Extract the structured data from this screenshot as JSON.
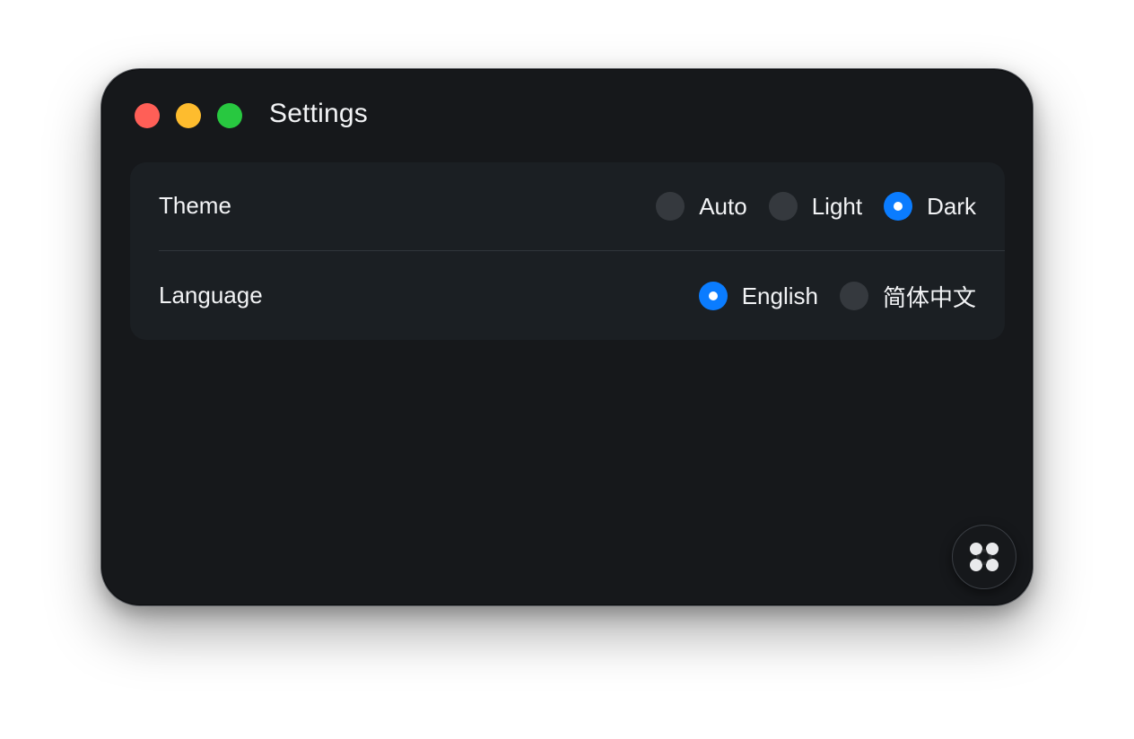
{
  "window": {
    "title": "Settings",
    "traffic_lights": {
      "close": "#ff5f57",
      "minimize": "#febc2e",
      "zoom": "#28c840"
    }
  },
  "settings": {
    "theme": {
      "label": "Theme",
      "options": [
        "Auto",
        "Light",
        "Dark"
      ],
      "selected": "Dark"
    },
    "language": {
      "label": "Language",
      "options": [
        "English",
        "简体中文"
      ],
      "selected": "English"
    }
  },
  "colors": {
    "accent": "#0a7cff",
    "background": "#16181b",
    "panel": "#1b1f23"
  },
  "fab": {
    "icon": "app-logo-icon"
  }
}
